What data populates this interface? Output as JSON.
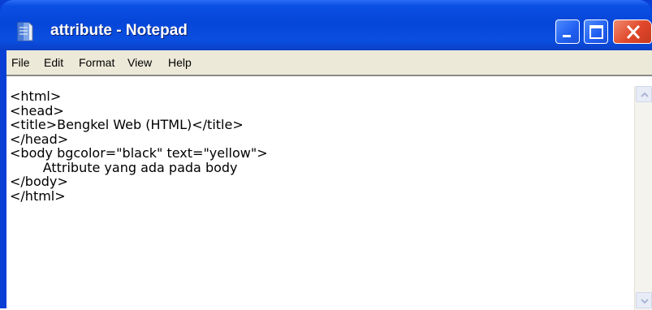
{
  "window": {
    "title": "attribute - Notepad",
    "icon": "notepad-icon",
    "controls": [
      "minimize-icon",
      "maximize-icon",
      "close-icon"
    ]
  },
  "menu": {
    "items": [
      "File",
      "Edit",
      "Format",
      "View",
      "Help"
    ]
  },
  "editor": {
    "content": "<html>\n<head>\n<title>Bengkel Web (HTML)</title>\n</head>\n<body bgcolor=\"black\" text=\"yellow\">\n\tAttribute yang ada pada body\n</body>\n</html>"
  },
  "colors": {
    "titlebar": "#0646d8",
    "menubar": "#ece9d8",
    "close_button": "#e0472a"
  }
}
